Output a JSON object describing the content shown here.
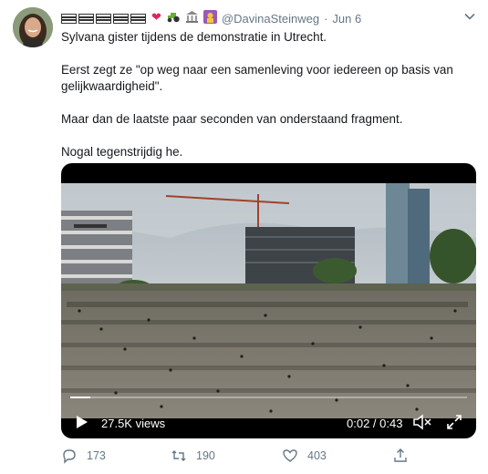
{
  "tweet": {
    "display_name_flags": 5,
    "display_name_emojis": [
      "heart-icon",
      "tractor-icon",
      "classical-building-icon",
      "woman-raising-hand-icon"
    ],
    "handle": "@DavinaSteinweg",
    "separator": "·",
    "date": "Jun 6",
    "paragraphs": [
      "Sylvana gister tijdens de demonstratie in Utrecht.",
      "Eerst zegt ze \"op weg naar een samenleving voor iedereen op basis van gelijkwaardigheid\".",
      "Maar dan de laatste paar seconden van onderstaand fragment.",
      "Nogal tegenstrijdig he."
    ]
  },
  "video": {
    "views": "27.5K views",
    "time": "0:02 / 0:43",
    "progress_fraction": 0.05
  },
  "actions": {
    "replies": "173",
    "retweets": "190",
    "likes": "403"
  },
  "colors": {
    "text": "#14171a",
    "muted": "#657786",
    "heart": "#e0245e"
  }
}
